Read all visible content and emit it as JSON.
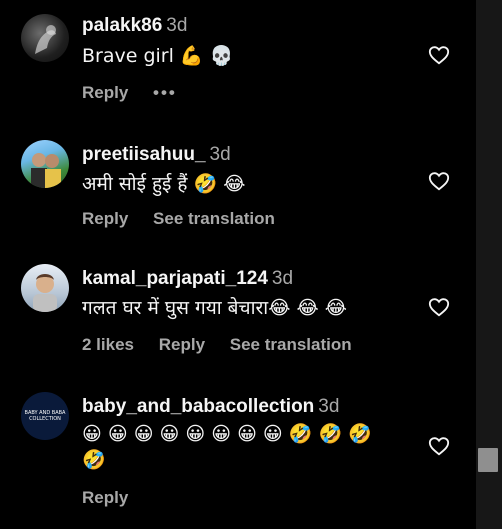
{
  "comments": [
    {
      "username": "palakk86",
      "time": "3d",
      "text": "Brave girl 💪 💀",
      "actions": {
        "reply": "Reply",
        "more": "•••"
      }
    },
    {
      "username": "preetiisahuu_",
      "time": "3d",
      "text": "अमी सोई हुई हैं 🤣 😂",
      "actions": {
        "reply": "Reply",
        "translate": "See translation"
      }
    },
    {
      "username": "kamal_parjapati_124",
      "time": "3d",
      "text": "गलत घर में घुस गया बेचारा😂 😂 😂",
      "actions": {
        "likes": "2 likes",
        "reply": "Reply",
        "translate": "See translation"
      }
    },
    {
      "username": "baby_and_babacollection",
      "time": "3d",
      "text_line1": "😀 😀 😀 😀 😀 😀 😀 😀 🤣 🤣 🤣",
      "text_line2": "🤣",
      "avatar_text": "BABY AND BABA COLLECTION",
      "actions": {
        "reply": "Reply"
      }
    }
  ],
  "icons": {
    "heart": "heart-outline-icon"
  },
  "colors": {
    "background": "#000000",
    "text": "#f5f5f5",
    "muted": "#a8a8a8"
  }
}
